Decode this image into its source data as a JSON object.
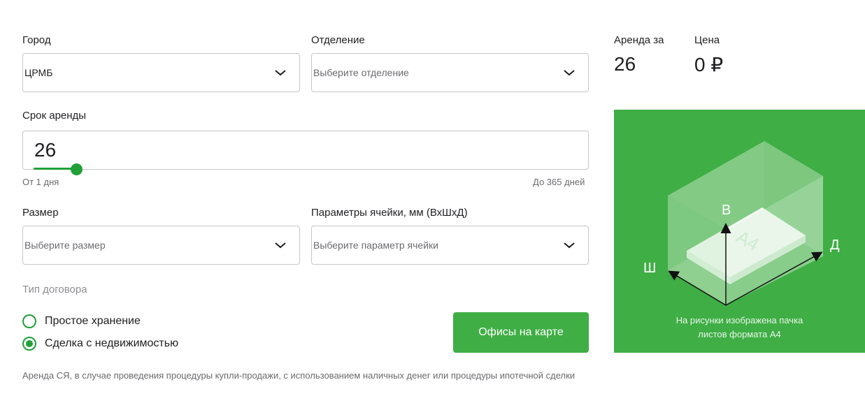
{
  "form": {
    "city": {
      "label": "Город",
      "value": "ЦРМБ"
    },
    "branch": {
      "label": "Отделение",
      "placeholder": "Выберите отделение"
    },
    "term": {
      "label": "Срок аренды",
      "value": "26",
      "slider_fraction": 0.068,
      "min_hint": "От 1 дня",
      "max_hint": "До 365 дней"
    },
    "size": {
      "label": "Размер",
      "placeholder": "Выберите размер"
    },
    "cell_params": {
      "label": "Параметры ячейки, мм (ВхШхД)",
      "placeholder": "Выберите параметр ячейки"
    },
    "contract": {
      "title": "Тип договора",
      "options": [
        {
          "label": "Простое хранение",
          "checked": false
        },
        {
          "label": "Сделка с недвижимостью",
          "checked": true
        }
      ]
    },
    "map_button": "Офисы на карте",
    "footnote": "Аренда СЯ, в случае проведения процедуры купли-продажи, с использованием наличных денег или процедуры ипотечной сделки"
  },
  "summary": {
    "rent_label": "Аренда за",
    "rent_value": "26",
    "price_label": "Цена",
    "price_value": "0 ₽"
  },
  "illustration": {
    "axis_height": "В",
    "axis_width": "Ш",
    "axis_length": "Д",
    "paper_label": "А4",
    "caption_line1": "На рисунки изображена пачка",
    "caption_line2": "листов формата А4"
  },
  "colors": {
    "accent": "#21a038",
    "button": "#3fae45",
    "panel": "#3fae45"
  },
  "icons": {
    "dropdown": "chevron-down-icon"
  }
}
